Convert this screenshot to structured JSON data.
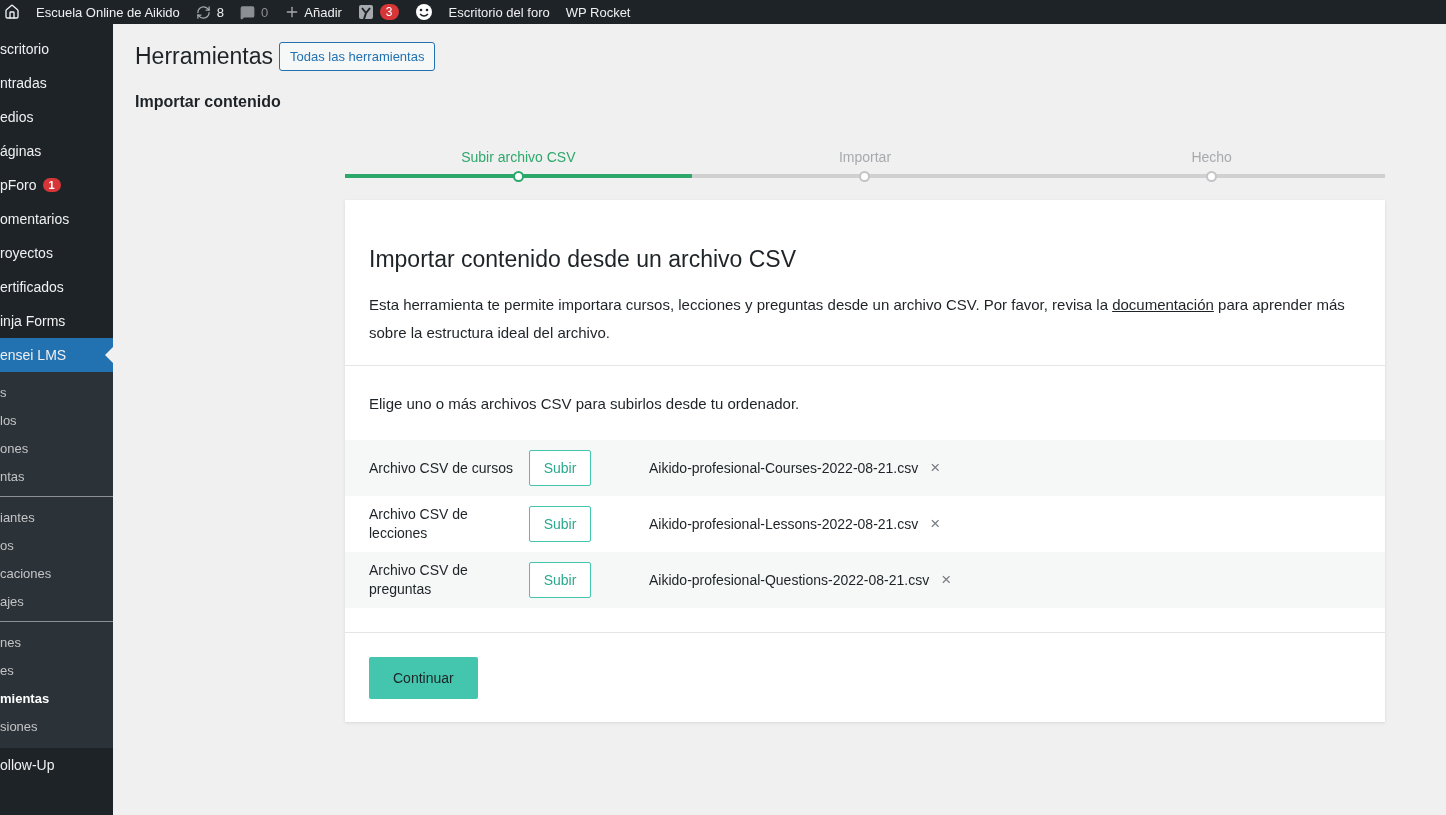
{
  "admin_bar": {
    "site": "Escuela Online de Aikido",
    "updates": "8",
    "comments": "0",
    "add": "Añadir",
    "yoast_count": "3",
    "links": [
      "Escritorio del foro",
      "WP Rocket"
    ]
  },
  "sidebar": {
    "items": [
      {
        "label": "scritorio",
        "selected": false,
        "kind": "main"
      },
      {
        "label": "ntradas",
        "selected": false,
        "kind": "main"
      },
      {
        "label": "edios",
        "selected": false,
        "kind": "main"
      },
      {
        "label": "áginas",
        "selected": false,
        "kind": "main"
      },
      {
        "label": "pForo",
        "selected": false,
        "kind": "main",
        "badge": "1"
      },
      {
        "label": "omentarios",
        "selected": false,
        "kind": "main"
      },
      {
        "label": "royectos",
        "selected": false,
        "kind": "main"
      },
      {
        "label": "ertificados",
        "selected": false,
        "kind": "main"
      },
      {
        "label": "inja Forms",
        "selected": false,
        "kind": "main"
      },
      {
        "label": "ensei LMS",
        "selected": true,
        "kind": "main"
      },
      {
        "label": "s",
        "selected": false,
        "kind": "sub"
      },
      {
        "label": "los",
        "selected": false,
        "kind": "sub"
      },
      {
        "label": "ones",
        "selected": false,
        "kind": "sub"
      },
      {
        "label": "ntas",
        "selected": false,
        "kind": "sub"
      },
      {
        "kind": "divider"
      },
      {
        "label": "iantes",
        "selected": false,
        "kind": "sub"
      },
      {
        "label": "os",
        "selected": false,
        "kind": "sub"
      },
      {
        "label": "caciones",
        "selected": false,
        "kind": "sub"
      },
      {
        "label": "ajes",
        "selected": false,
        "kind": "sub"
      },
      {
        "kind": "divider"
      },
      {
        "label": "nes",
        "selected": false,
        "kind": "sub"
      },
      {
        "label": "es",
        "selected": false,
        "kind": "sub"
      },
      {
        "label": "mientas",
        "selected": true,
        "kind": "sub"
      },
      {
        "label": "siones",
        "selected": false,
        "kind": "sub"
      },
      {
        "label": "ollow-Up",
        "selected": false,
        "kind": "main"
      }
    ]
  },
  "page": {
    "title": "Herramientas",
    "title_button": "Todas las herramientas",
    "subtitle": "Importar contenido"
  },
  "steps": [
    {
      "label": "Subir archivo CSV",
      "selected": true
    },
    {
      "label": "Importar",
      "selected": false
    },
    {
      "label": "Hecho",
      "selected": false
    }
  ],
  "card": {
    "heading": "Importar contenido desde un archivo CSV",
    "intro_before": "Esta herramienta te permite importara cursos, lecciones y preguntas desde un archivo CSV. Por favor, revisa la ",
    "intro_link": "documentación",
    "intro_after": " para aprender más sobre la estructura ideal del archivo.",
    "prompt": "Elige uno o más archivos CSV para subirlos desde tu ordenador.",
    "files": [
      {
        "label": "Archivo CSV de cursos",
        "button": "Subir",
        "file": "Aikido-profesional-Courses-2022-08-21.csv",
        "remove": "×"
      },
      {
        "label": "Archivo CSV de lecciones",
        "button": "Subir",
        "file": "Aikido-profesional-Lessons-2022-08-21.csv",
        "remove": "×"
      },
      {
        "label": "Archivo CSV de preguntas",
        "button": "Subir",
        "file": "Aikido-profesional-Questions-2022-08-21.csv",
        "remove": "×"
      }
    ],
    "continue": "Continuar"
  }
}
